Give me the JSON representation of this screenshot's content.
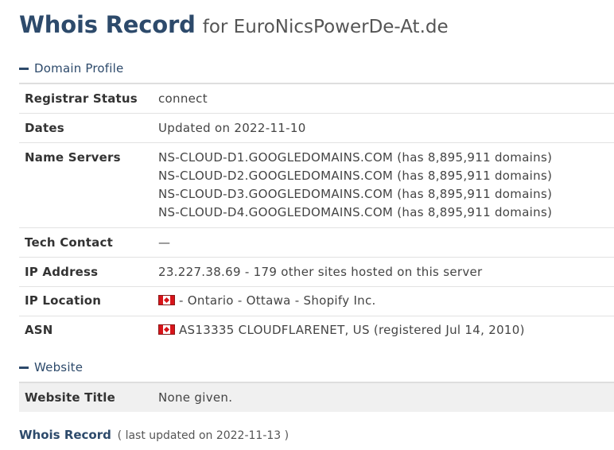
{
  "title": {
    "main": "Whois Record",
    "for": "for EuroNicsPowerDe-At.de"
  },
  "domain_profile": {
    "header": "Domain Profile",
    "rows": [
      {
        "label": "Registrar Status",
        "lines": [
          "connect"
        ]
      },
      {
        "label": "Dates",
        "lines": [
          "Updated on 2022-11-10"
        ]
      },
      {
        "label": "Name Servers",
        "lines": [
          "NS-CLOUD-D1.GOOGLEDOMAINS.COM (has 8,895,911 domains)",
          "NS-CLOUD-D2.GOOGLEDOMAINS.COM (has 8,895,911 domains)",
          "NS-CLOUD-D3.GOOGLEDOMAINS.COM (has 8,895,911 domains)",
          "NS-CLOUD-D4.GOOGLEDOMAINS.COM (has 8,895,911 domains)"
        ]
      },
      {
        "label": "Tech Contact",
        "lines": [
          "—"
        ]
      },
      {
        "label": "IP Address",
        "lines": [
          "23.227.38.69 - 179 other sites hosted on this server"
        ]
      },
      {
        "label": "IP Location",
        "flag_icon": "canada-flag-icon",
        "lines": [
          "- Ontario - Ottawa - Shopify Inc."
        ]
      },
      {
        "label": "ASN",
        "flag_icon": "canada-flag-icon",
        "lines": [
          "AS13335 CLOUDFLARENET, US (registered Jul 14, 2010)"
        ]
      }
    ]
  },
  "website": {
    "header": "Website",
    "rows": [
      {
        "label": "Website Title",
        "lines": [
          "None given."
        ]
      }
    ]
  },
  "footer": {
    "link": "Whois Record",
    "note": "( last updated on 2022-11-13 )"
  },
  "colors": {
    "heading": "#2d4a6b",
    "text": "#333333",
    "flag_red": "#d7141a"
  }
}
